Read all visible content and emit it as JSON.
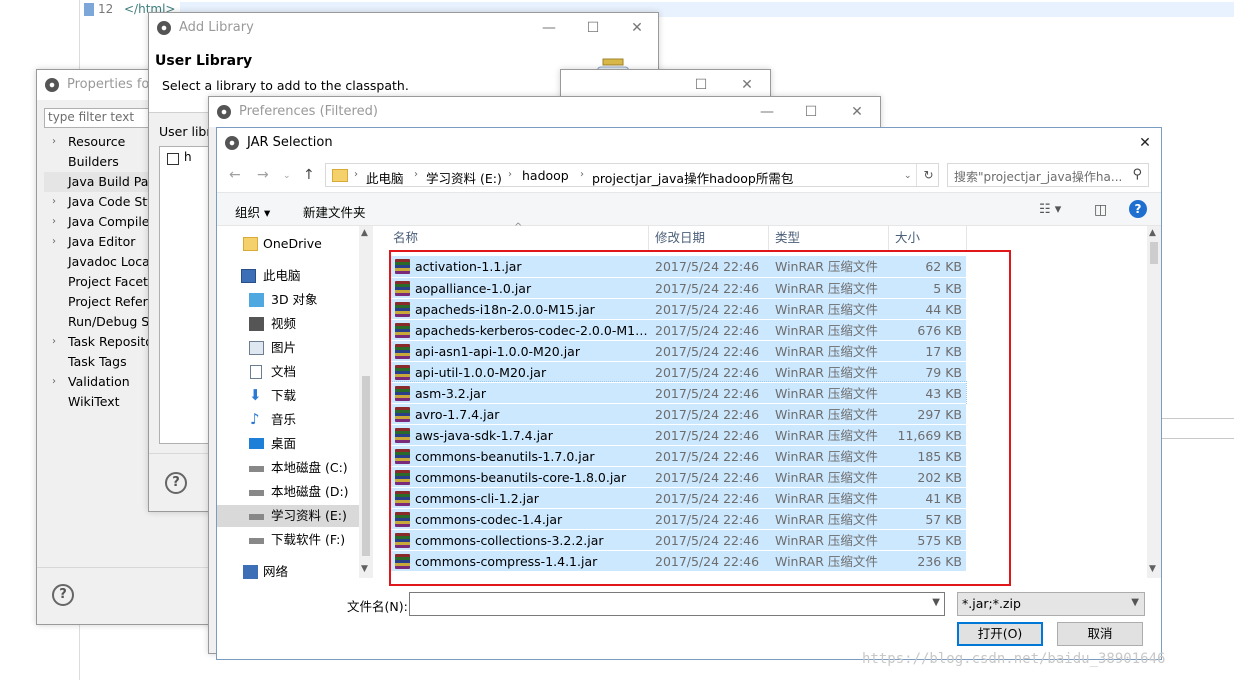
{
  "editor": {
    "line_number": "12",
    "code": "</html>"
  },
  "properties": {
    "title": "Properties for",
    "filter_placeholder": "type filter text",
    "tree": [
      {
        "label": "Resource",
        "expandable": true
      },
      {
        "label": "Builders",
        "expandable": false
      },
      {
        "label": "Java Build Path",
        "expandable": false,
        "selected": true
      },
      {
        "label": "Java Code Style",
        "expandable": true
      },
      {
        "label": "Java Compiler",
        "expandable": true
      },
      {
        "label": "Java Editor",
        "expandable": true
      },
      {
        "label": "Javadoc Location",
        "expandable": false
      },
      {
        "label": "Project Facets",
        "expandable": false
      },
      {
        "label": "Project References",
        "expandable": false
      },
      {
        "label": "Run/Debug Settings",
        "expandable": false
      },
      {
        "label": "Task Repository",
        "expandable": true
      },
      {
        "label": "Task Tags",
        "expandable": false
      },
      {
        "label": "Validation",
        "expandable": true
      },
      {
        "label": "WikiText",
        "expandable": false
      }
    ],
    "help": "?"
  },
  "add_library": {
    "title": "Add Library",
    "heading": "User Library",
    "description": "Select a library to add to the classpath.",
    "user_libraries_label": "User libr",
    "list_item": "h",
    "help": "?"
  },
  "preferences": {
    "title": "Preferences (Filtered)"
  },
  "jar_selection": {
    "title": "JAR Selection",
    "close": "✕",
    "breadcrumbs": [
      "此电脑",
      "学习资料 (E:)",
      "hadoop",
      "projectjar_java操作hadoop所需包"
    ],
    "search_placeholder": "搜索\"projectjar_java操作ha...",
    "toolbar": {
      "organize": "组织 ▾",
      "new_folder": "新建文件夹",
      "help": "?"
    },
    "nav": [
      {
        "label": "OneDrive",
        "icon": "folder-icon"
      },
      {
        "label": "此电脑",
        "icon": "computer-icon"
      },
      {
        "label": "3D 对象",
        "icon": "cube-icon"
      },
      {
        "label": "视频",
        "icon": "video-icon"
      },
      {
        "label": "图片",
        "icon": "picture-icon"
      },
      {
        "label": "文档",
        "icon": "document-icon"
      },
      {
        "label": "下载",
        "icon": "download-icon"
      },
      {
        "label": "音乐",
        "icon": "music-icon"
      },
      {
        "label": "桌面",
        "icon": "desktop-icon"
      },
      {
        "label": "本地磁盘 (C:)",
        "icon": "drive-icon"
      },
      {
        "label": "本地磁盘 (D:)",
        "icon": "drive-icon"
      },
      {
        "label": "学习资料 (E:)",
        "icon": "drive-icon",
        "selected": true
      },
      {
        "label": "下载软件 (F:)",
        "icon": "drive-icon"
      },
      {
        "label": "网络",
        "icon": "network-icon"
      }
    ],
    "columns": [
      "名称",
      "修改日期",
      "类型",
      "大小"
    ],
    "files": [
      {
        "name": "activation-1.1.jar",
        "date": "2017/5/24 22:46",
        "type": "WinRAR 压缩文件",
        "size": "62 KB"
      },
      {
        "name": "aopalliance-1.0.jar",
        "date": "2017/5/24 22:46",
        "type": "WinRAR 压缩文件",
        "size": "5 KB"
      },
      {
        "name": "apacheds-i18n-2.0.0-M15.jar",
        "date": "2017/5/24 22:46",
        "type": "WinRAR 压缩文件",
        "size": "44 KB"
      },
      {
        "name": "apacheds-kerberos-codec-2.0.0-M15...",
        "date": "2017/5/24 22:46",
        "type": "WinRAR 压缩文件",
        "size": "676 KB"
      },
      {
        "name": "api-asn1-api-1.0.0-M20.jar",
        "date": "2017/5/24 22:46",
        "type": "WinRAR 压缩文件",
        "size": "17 KB"
      },
      {
        "name": "api-util-1.0.0-M20.jar",
        "date": "2017/5/24 22:46",
        "type": "WinRAR 压缩文件",
        "size": "79 KB"
      },
      {
        "name": "asm-3.2.jar",
        "date": "2017/5/24 22:46",
        "type": "WinRAR 压缩文件",
        "size": "43 KB"
      },
      {
        "name": "avro-1.7.4.jar",
        "date": "2017/5/24 22:46",
        "type": "WinRAR 压缩文件",
        "size": "297 KB"
      },
      {
        "name": "aws-java-sdk-1.7.4.jar",
        "date": "2017/5/24 22:46",
        "type": "WinRAR 压缩文件",
        "size": "11,669 KB"
      },
      {
        "name": "commons-beanutils-1.7.0.jar",
        "date": "2017/5/24 22:46",
        "type": "WinRAR 压缩文件",
        "size": "185 KB"
      },
      {
        "name": "commons-beanutils-core-1.8.0.jar",
        "date": "2017/5/24 22:46",
        "type": "WinRAR 压缩文件",
        "size": "202 KB"
      },
      {
        "name": "commons-cli-1.2.jar",
        "date": "2017/5/24 22:46",
        "type": "WinRAR 压缩文件",
        "size": "41 KB"
      },
      {
        "name": "commons-codec-1.4.jar",
        "date": "2017/5/24 22:46",
        "type": "WinRAR 压缩文件",
        "size": "57 KB"
      },
      {
        "name": "commons-collections-3.2.2.jar",
        "date": "2017/5/24 22:46",
        "type": "WinRAR 压缩文件",
        "size": "575 KB"
      },
      {
        "name": "commons-compress-1.4.1.jar",
        "date": "2017/5/24 22:46",
        "type": "WinRAR 压缩文件",
        "size": "236 KB"
      }
    ],
    "filename_label": "文件名(N):",
    "filename_value": "",
    "filetype": "*.jar;*.zip",
    "open_button": "打开(O)",
    "cancel_button": "取消"
  },
  "watermark": "https://blog.csdn.net/baidu_38901646",
  "colors": {
    "selection": "#cce8ff",
    "highlight_box": "#e0161a",
    "primary_border": "#0078d7"
  }
}
